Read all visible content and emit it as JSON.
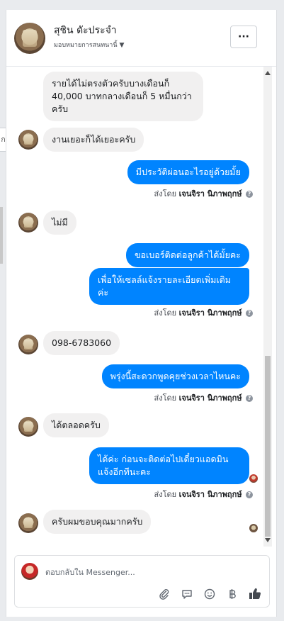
{
  "header": {
    "contact_name": "สุชิน ดัะประจำ",
    "assign_label": "มอบหมายการสนทนานี้",
    "more_label": "···"
  },
  "left_tab_label": "ก",
  "messages": [
    {
      "dir": "in",
      "text": "รายได้ไม่ตรงตัวครับบางเดือนก็ 40,000 บาทกลางเดือนก็ 5 หมื่นกว่าครับ"
    },
    {
      "dir": "in",
      "text": "งานเยอะก็ได้เยอะครับ"
    },
    {
      "dir": "out",
      "text": "มีประวัติผ่อนอะไรอยู่ด้วยมั้ย"
    },
    {
      "dir": "in",
      "text": "ไม่มี"
    },
    {
      "dir": "out",
      "text": "ขอเบอร์ติดต่อลูกค้าได้มั้ยคะ"
    },
    {
      "dir": "out",
      "text": "เพื่อให้เซลล์แจ้งรายละเอียดเพิ่มเติมค่ะ"
    },
    {
      "dir": "in",
      "text": "098-6783060"
    },
    {
      "dir": "out",
      "text": "พรุ่งนี้สะดวกพูดคุยช่วงเวลาไหนคะ"
    },
    {
      "dir": "in",
      "text": "ได้ตลอดครับ"
    },
    {
      "dir": "out",
      "text": "ได้ค่ะ ก่อนจะติดต่อไปเดี๋ยวแอดมินแจ้งอีกทีนะคะ"
    },
    {
      "dir": "in",
      "text": "ครับผมขอบคุณมากครับ"
    }
  ],
  "sent_by": {
    "prefix": "ส่งโดย",
    "name": "เจนจิรา นิภาพฤกษ์",
    "info": "?"
  },
  "composer": {
    "placeholder": "ตอบกลับใน Messenger..."
  },
  "icons": {
    "attach": "paperclip-icon",
    "saved_replies": "speech-bubble-icon",
    "emoji": "smiley-icon",
    "payment": "baht-icon",
    "like": "thumbs-up-icon"
  },
  "colors": {
    "outgoing_bubble": "#0084ff",
    "incoming_bubble": "#f1f0f0",
    "background": "#e9ebee"
  }
}
